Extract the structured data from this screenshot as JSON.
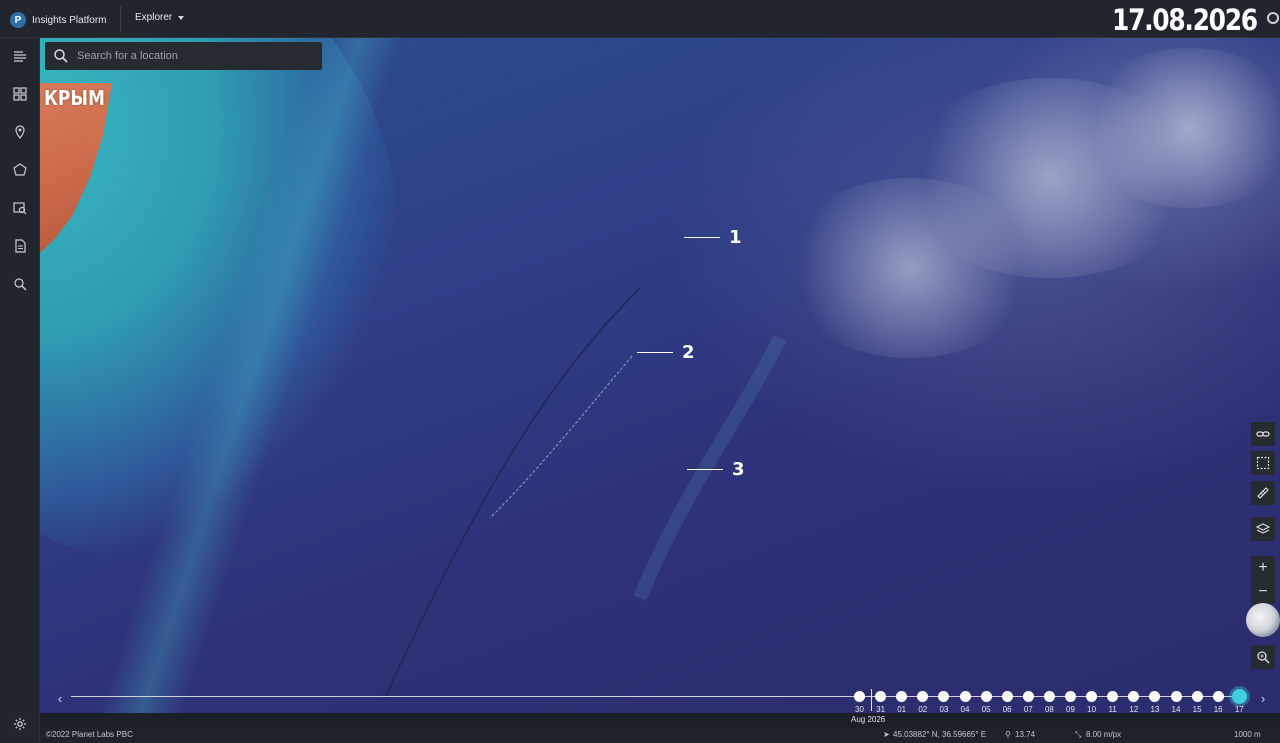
{
  "header": {
    "brand_letter": "P",
    "brand_name": "Insights Platform",
    "nav_label": "Explorer",
    "date": "17.08.2026"
  },
  "search": {
    "placeholder": "Search for a location"
  },
  "map": {
    "region_label": "КРЫМ",
    "markers": [
      "1",
      "2",
      "3"
    ]
  },
  "sidebar": {
    "items": [
      "catalog-icon",
      "dashboard-icon",
      "location-pin-icon",
      "polygon-icon",
      "image-search-icon",
      "report-icon",
      "analytics-icon"
    ],
    "settings": "gear-icon"
  },
  "tools": {
    "items": [
      "link-icon",
      "select-area-icon",
      "ruler-icon",
      "layers-icon"
    ],
    "zoom_in": "+",
    "zoom_out": "−"
  },
  "timeline": {
    "dates": [
      "30",
      "31",
      "01",
      "02",
      "03",
      "04",
      "05",
      "06",
      "07",
      "08",
      "09",
      "10",
      "11",
      "12",
      "13",
      "14",
      "15",
      "16",
      "17"
    ],
    "month_label": "Aug 2026",
    "selected": "17",
    "prev": "‹",
    "next": "›"
  },
  "status": {
    "copyright": "©2022 Planet Labs PBC",
    "coordinates": "45.03882° N, 36.59665° E",
    "zoom": "13.74",
    "resolution": "8.00 m/px",
    "scale": "1000 m"
  },
  "colors": {
    "accent": "#3fd0e0",
    "land": "#c96849",
    "sea": "#2e3278",
    "shallow": "#38b7c0"
  }
}
